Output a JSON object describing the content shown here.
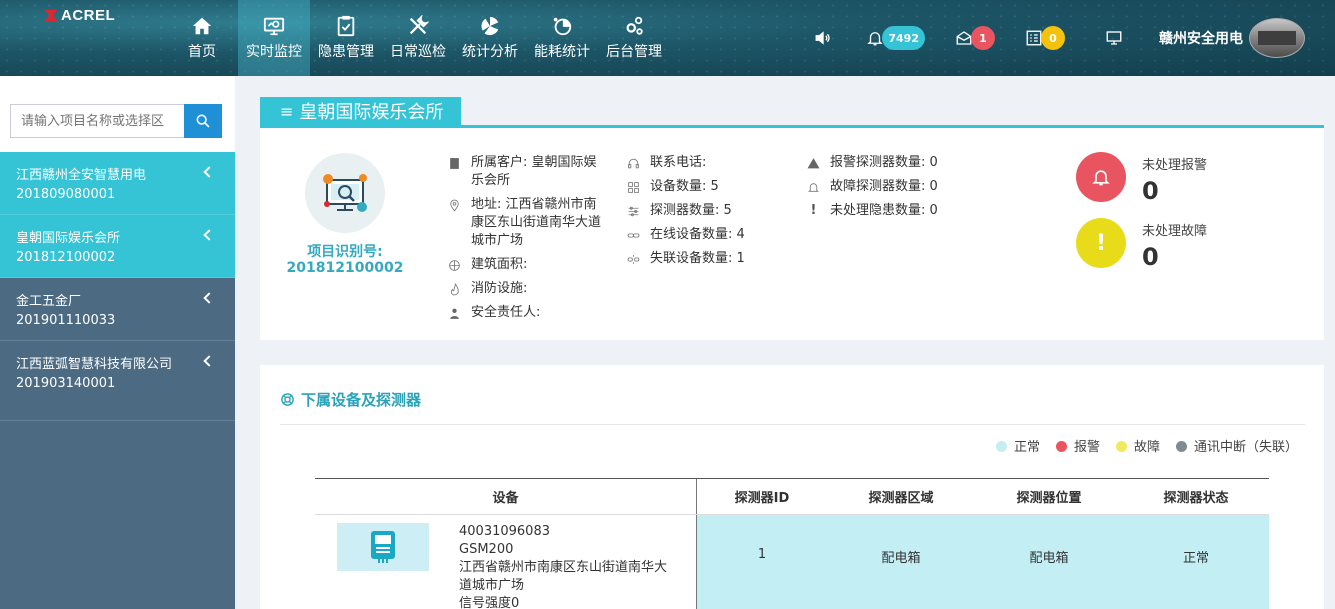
{
  "header": {
    "logo": "ACREL",
    "nav": [
      {
        "label": "首页",
        "icon": "home-icon",
        "active": false
      },
      {
        "label": "实时监控",
        "icon": "monitor-icon",
        "active": true
      },
      {
        "label": "隐患管理",
        "icon": "clipboard-icon",
        "active": false
      },
      {
        "label": "日常巡检",
        "icon": "tools-icon",
        "active": false
      },
      {
        "label": "统计分析",
        "icon": "chart-icon",
        "active": false
      },
      {
        "label": "能耗统计",
        "icon": "energy-icon",
        "active": false
      },
      {
        "label": "后台管理",
        "icon": "gears-icon",
        "active": false
      }
    ],
    "notifications": {
      "bell_count": "7492",
      "mail_count": "1",
      "task_count": "0"
    },
    "badge_colors": {
      "bell": "#35c4d6",
      "mail": "#e85560",
      "task": "#f4c20d"
    },
    "user_name": "赣州安全用电"
  },
  "sidebar": {
    "search_placeholder": "请输入项目名称或选择区",
    "projects": [
      {
        "name": "江西赣州全安智慧用电",
        "id": "201809080001",
        "highlight": true
      },
      {
        "name": "皇朝国际娱乐会所",
        "id": "201812100002",
        "highlight": true
      },
      {
        "name": "金工五金厂",
        "id": "201901110033",
        "highlight": false
      },
      {
        "name": "江西蓝弧智慧科技有限公司",
        "id": "201903140001",
        "highlight": false
      }
    ]
  },
  "project": {
    "title": "皇朝国际娱乐会所",
    "id_label": "项目识别号:",
    "id_value": "201812100002",
    "info_col1": {
      "customer": "所属客户: 皇朝国际娱乐会所",
      "address": "地址: 江西省赣州市南康区东山街道南华大道城市广场",
      "area": "建筑面积:",
      "fire": "消防设施:",
      "person": "安全责任人:"
    },
    "info_col2": {
      "phone": "联系电话:",
      "devices": "设备数量: 5",
      "detectors": "探测器数量: 5",
      "online": "在线设备数量: 4",
      "offline": "失联设备数量: 1"
    },
    "info_col3": {
      "alarm_detectors": "报警探测器数量: 0",
      "fault_detectors": "故障探测器数量: 0",
      "hazards": "未处理隐患数量: 0"
    },
    "alarm": {
      "label": "未处理报警",
      "value": "0",
      "color": "#e85560"
    },
    "fault": {
      "label": "未处理故障",
      "value": "0",
      "color": "#e8dc1a"
    }
  },
  "devices": {
    "title": "下属设备及探测器",
    "legend": [
      {
        "label": "正常",
        "color": "#c2eef4"
      },
      {
        "label": "报警",
        "color": "#e85560"
      },
      {
        "label": "故障",
        "color": "#f2ea5e"
      },
      {
        "label": "通讯中断（失联）",
        "color": "#7f8b93"
      }
    ],
    "columns": {
      "device": "设备",
      "id": "探测器ID",
      "area": "探测器区域",
      "position": "探测器位置",
      "status": "探测器状态"
    },
    "rows": [
      {
        "device_code": "40031096083",
        "device_model": "GSM200",
        "device_address": "江西省赣州市南康区东山街道南华大道城市广场",
        "device_signal": "信号强度0",
        "detector_id": "1",
        "area": "配电箱",
        "position": "配电箱",
        "status": "正常"
      }
    ]
  }
}
